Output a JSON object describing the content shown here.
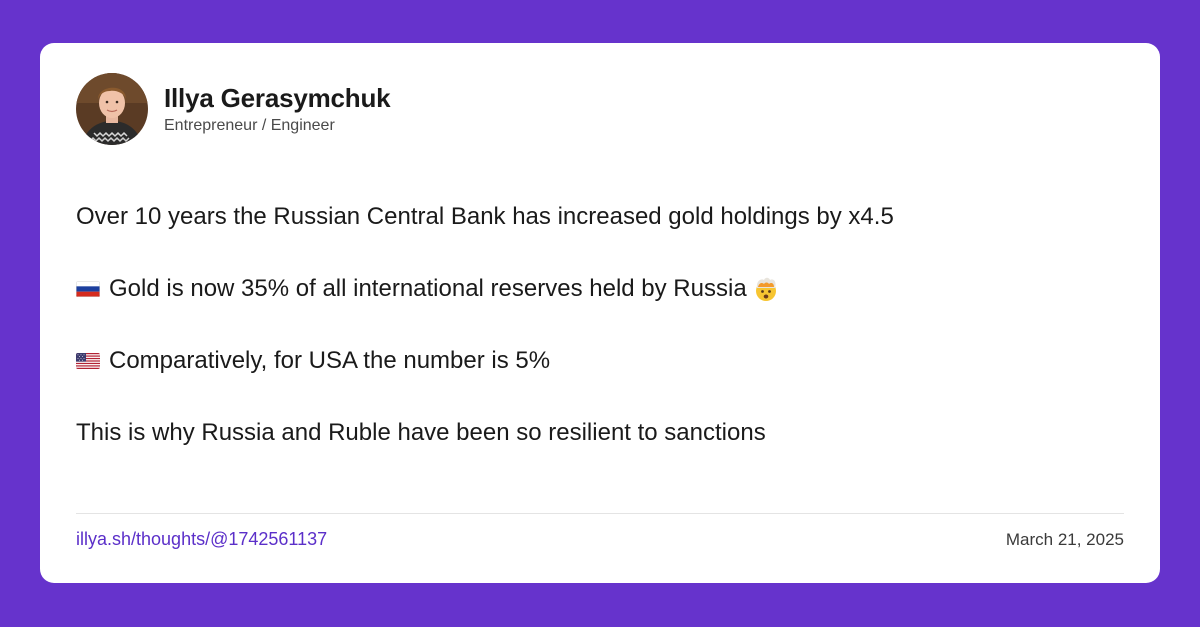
{
  "colors": {
    "background": "#6633cc",
    "card": "#ffffff",
    "text": "#1a1a1a",
    "link": "#5b2fc9"
  },
  "author": {
    "name": "Illya Gerasymchuk",
    "role": "Entrepreneur / Engineer",
    "avatar_icon": "profile-photo"
  },
  "post": {
    "lines": [
      {
        "text": "Over 10 years the Russian Central Bank has increased gold holdings by x4.5"
      },
      {
        "flag_icon": "russia-flag-icon",
        "text": "Gold is now 35% of all international reserves held by Russia",
        "trailing_emoji_icon": "exploding-head-emoji"
      },
      {
        "flag_icon": "usa-flag-icon",
        "text": "Comparatively, for USA the number is 5%"
      },
      {
        "text": "This is why Russia and Ruble have been so resilient to sanctions"
      }
    ]
  },
  "footer": {
    "link": "illya.sh/thoughts/@1742561137",
    "date": "March 21, 2025"
  }
}
